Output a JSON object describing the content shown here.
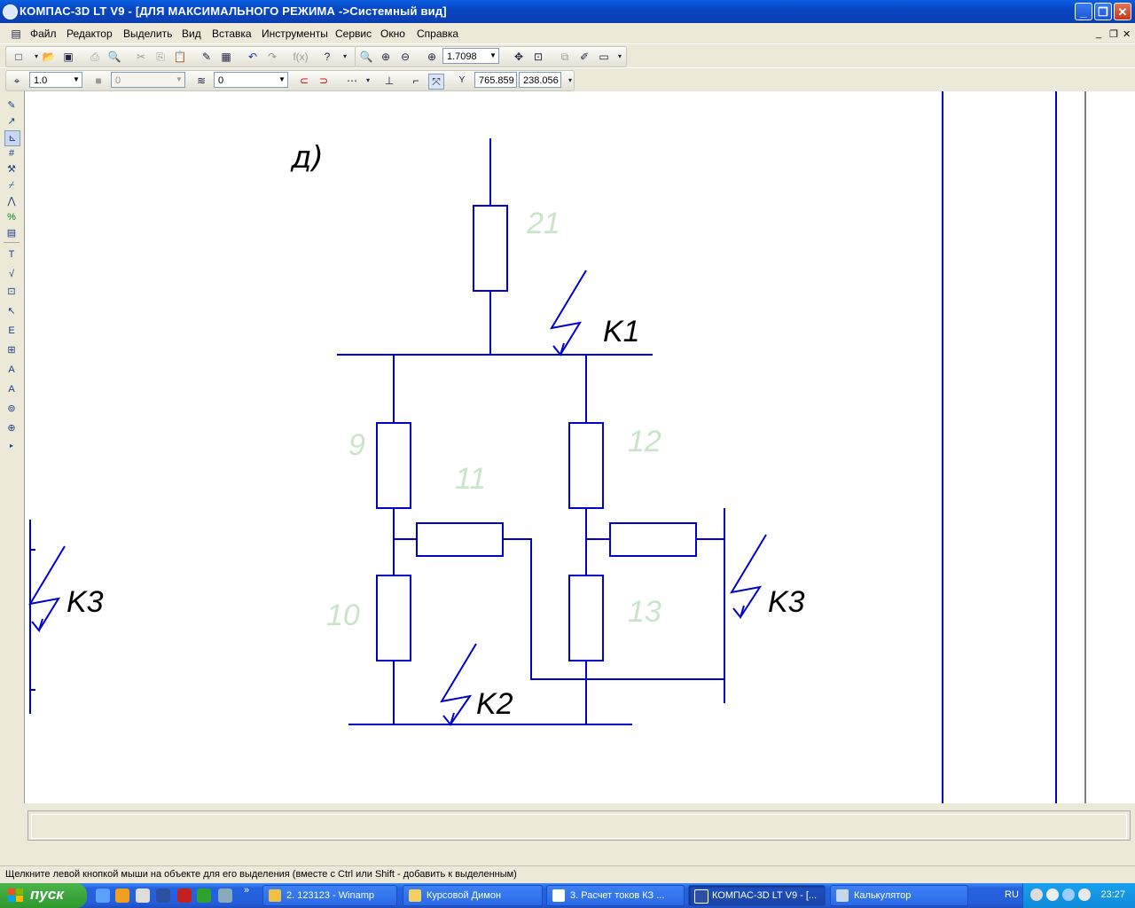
{
  "window": {
    "title": "КОМПАС-3D LT V9 - [ДЛЯ МАКСИМАЛЬНОГО РЕЖИМА ->Системный вид]",
    "controls": [
      "minimize-icon",
      "restore-icon",
      "close-icon"
    ]
  },
  "menu": {
    "items": [
      "Файл",
      "Редактор",
      "Выделить",
      "Вид",
      "Вставка",
      "Инструменты",
      "Сервис",
      "Окно",
      "Справка"
    ],
    "doc_controls": [
      "minimize-icon",
      "restore-icon",
      "close-icon"
    ]
  },
  "toolbar1": {
    "zoom_value": "1.7098",
    "formula_label": "f(x)"
  },
  "toolbar2": {
    "scale_value": "1.0",
    "style_value": "0",
    "layer_value": "0",
    "coord_x": "765.859",
    "coord_y": "238.056"
  },
  "drawing": {
    "sheet_label": "д)",
    "resistor_labels": [
      "21",
      "9",
      "11",
      "12",
      "10",
      "13"
    ],
    "fault_labels": [
      "K1",
      "K2",
      "K3",
      "K3"
    ],
    "colors": {
      "lines": "#0000cc",
      "labels": "#c9e4c9",
      "text": "#000000"
    }
  },
  "status": {
    "hint": "Щелкните левой кнопкой мыши на объекте для его выделения (вместе с Ctrl или Shift - добавить к выделенным)"
  },
  "taskbar": {
    "start_label": "пуск",
    "tasks": [
      "2. 123123 - Winamp",
      "Курсовой Димон",
      "3. Расчет токов КЗ ...",
      "КОМПАС-3D LT V9 - [...",
      "Калькулятор"
    ],
    "language": "RU",
    "clock": "23:27"
  }
}
